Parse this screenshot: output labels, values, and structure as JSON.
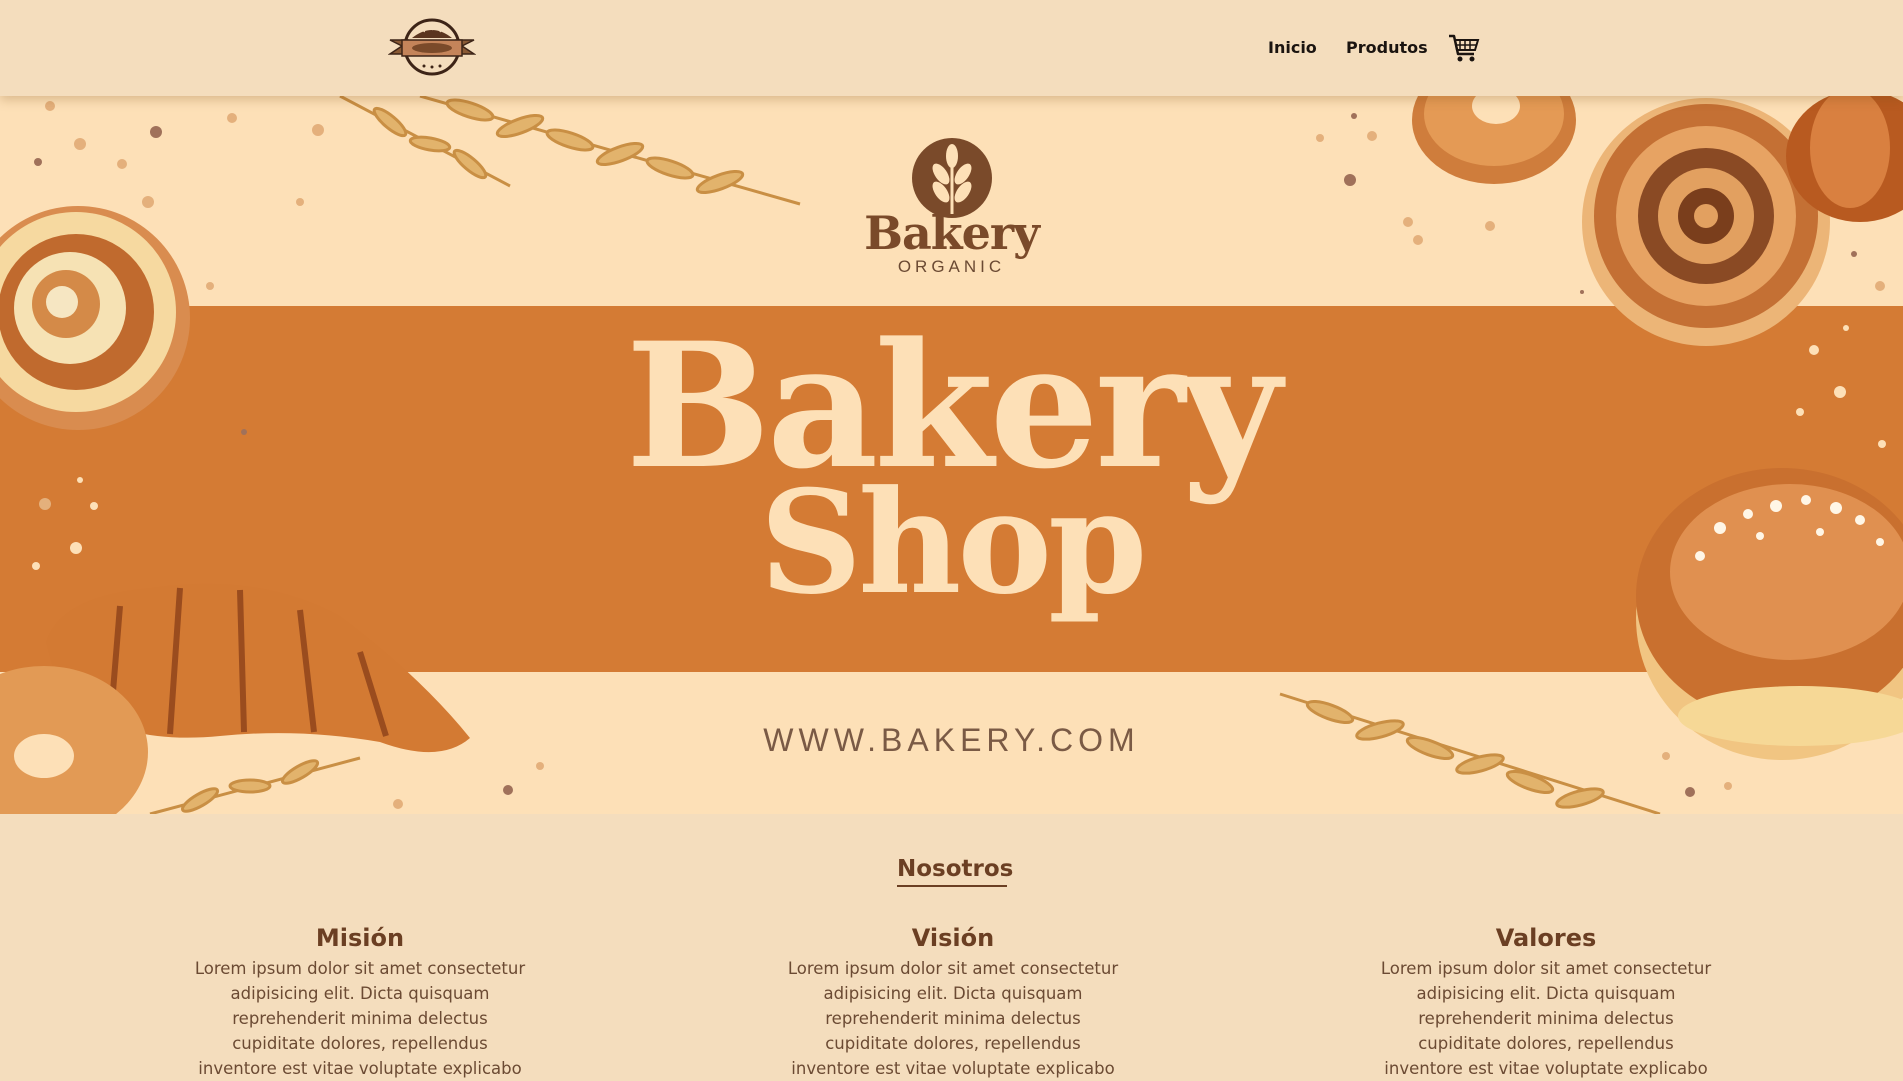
{
  "nav": {
    "logo_icon": "bakery-emblem-icon",
    "links": [
      {
        "label": "Inicio"
      },
      {
        "label": "Produtos"
      }
    ],
    "cart_icon": "shopping-cart-icon"
  },
  "hero": {
    "emblem_word": "Bakery",
    "emblem_sub": "ORGANIC",
    "title_line1": "Bakery",
    "title_line2": "Shop",
    "url": "WWW.BAKERY.COM",
    "colors": {
      "background": "#fde0b7",
      "band": "#d47b34",
      "title": "#fde0b7",
      "emblem": "#7a4a2a"
    }
  },
  "about": {
    "title": "Nosotros",
    "columns": [
      {
        "heading": "Misión",
        "lines": [
          "Lorem ipsum dolor sit amet consectetur",
          "adipisicing elit. Dicta quisquam",
          "reprehenderit minima delectus",
          "cupiditate dolores, repellendus",
          "inventore est vitae voluptate explicabo"
        ]
      },
      {
        "heading": "Visión",
        "lines": [
          "Lorem ipsum dolor sit amet consectetur",
          "adipisicing elit. Dicta quisquam",
          "reprehenderit minima delectus",
          "cupiditate dolores, repellendus",
          "inventore est vitae voluptate explicabo"
        ]
      },
      {
        "heading": "Valores",
        "lines": [
          "Lorem ipsum dolor sit amet consectetur",
          "adipisicing elit. Dicta quisquam",
          "reprehenderit minima delectus",
          "cupiditate dolores, repellendus",
          "inventore est vitae voluptate explicabo"
        ]
      }
    ]
  }
}
